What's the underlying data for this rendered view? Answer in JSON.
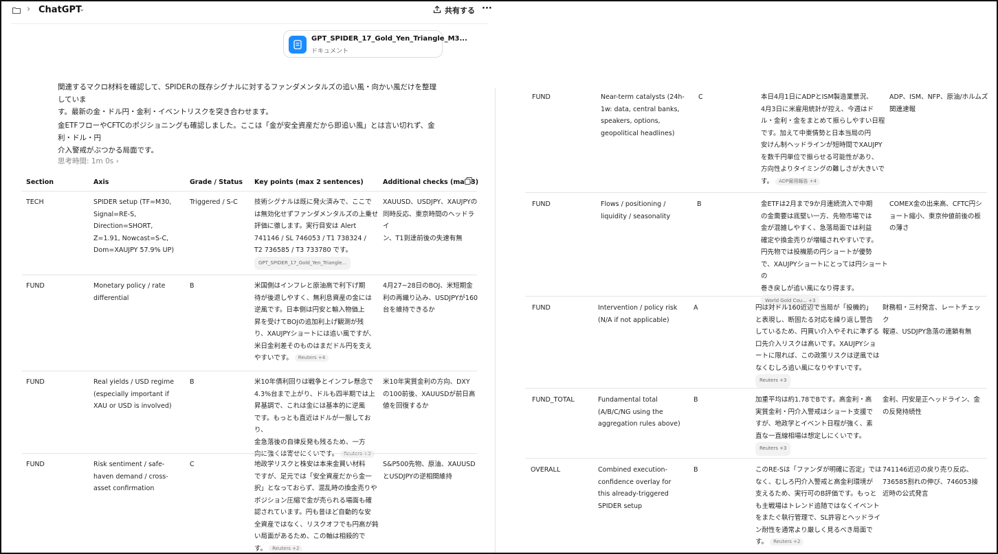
{
  "header": {
    "app_title": "ChatGPT",
    "share_label": "共有する",
    "more_label": "···"
  },
  "doc_card": {
    "name": "GPT_SPIDER_17_Gold_Yen_Triangle_M3...",
    "type": "ドキュメント"
  },
  "paragraphs": [
    "関連するマクロ材料を確認して、SPIDERの既存シグナルに対するファンダメンタルズの追い風・向かい風だけを整理していま",
    "す。最新の金・ドル円・金利・イベントリスクを突き合わせます。",
    "金ETFフローやCFTCのポジショニングも確認しました。ここは「金が安全資産だから即追い風」とは言い切れず、金利・ドル・円",
    "介入警戒がぶつかる局面です。"
  ],
  "thinking_label": "思考時間: 1m 0s ›",
  "table": {
    "headers": [
      "Section",
      "Axis",
      "Grade / Status",
      "Key points (max 2 sentences)",
      "Additional checks (max 3)"
    ],
    "rows_left": [
      {
        "section": "TECH",
        "axis": [
          "SPIDER setup (TF=M30,",
          "Signal=RE-S,",
          "Direction=SHORT,",
          "Z=1.91, Nowcast=S-C,",
          "Dom=XAUJPY 57.9% UP)"
        ],
        "grade": "Triggered / S-C",
        "key": [
          "技術シグナルは既に発火済みで、ここで",
          "は無効化せずファンダメンタルズの上乗せ",
          "評価に徹します。実行目安は Alert",
          "741146 / SL 746053 / T1 738324 /",
          "T2 736585 / T3 733780 です。"
        ],
        "source": "GPT_SPIDER_17_Gold_Yen_Triangle...",
        "checks": [
          "XAUUSD、USDJPY、XAUJPYの",
          "同時反応、東京時間のヘッドライ",
          "ン、T1到達前後の失速有無"
        ]
      },
      {
        "section": "FUND",
        "axis": [
          "Monetary policy / rate",
          "differential"
        ],
        "grade": "B",
        "key": [
          "米国側はインフレと原油高で利下げ期",
          "待が後退しやすく、無利息資産の金には",
          "逆風です。日本側は円安と輸入物価上",
          "昇を受けてBOJの追加利上げ観測が残",
          "り、XAUJPYショートには追い風ですが、",
          "米日金利差そのものはまだドル円を支え",
          "やすいです。"
        ],
        "source": "Reuters +4",
        "checks": [
          "4月27~28日のBOJ、米短期金",
          "利の再織り込み、USDJPYが160",
          "台を維持できるか"
        ]
      },
      {
        "section": "FUND",
        "axis": [
          "Real yields / USD regime",
          "(especially important if",
          "XAU or USD is involved)"
        ],
        "grade": "B",
        "key": [
          "米10年債利回りは戦争とインフレ懸念で",
          "4.3%台まで上がり、ドルも四半期では上",
          "昇基調で、これは金には基本的に逆風",
          "です。もっとも直近はドルが一服しており、",
          "金急落後の自律反発も残るため、一方",
          "向に強くは寄せにくいです。"
        ],
        "source": "Reuters +3",
        "checks": [
          "米10年実質金利の方向、DXY",
          "の100前後、XAUUSDが前日高",
          "値を回復するか"
        ]
      },
      {
        "section": "FUND",
        "axis": [
          "Risk sentiment / safe-",
          "haven demand / cross-",
          "asset confirmation"
        ],
        "grade": "C",
        "key": [
          "地政学リスクと株安は本来金買い材料",
          "ですが、足元では「安全資産だから金一",
          "択」となっておらず、混乱時の換金売りや",
          "ポジション圧縮で金が売られる場面も確",
          "認されています。円も昔ほど自動的な安",
          "全資産ではなく、リスクオフでも円高が鈍",
          "い局面があるため、この軸は相殺的で",
          "す。"
        ],
        "source": "Reuters +2",
        "checks": [
          "S&P500先物、原油、XAUUSD",
          "とUSDJPYの逆相関維持"
        ]
      }
    ],
    "rows_right": [
      {
        "section": "FUND",
        "axis": [
          "Near-term catalysts (24h-",
          "1w: data, central banks,",
          "speakers, options,",
          "geopolitical headlines)"
        ],
        "grade": "C",
        "key": [
          "本日4月1日にADPとISM製造業景況、",
          "4月3日に米雇用統計が控え、今週はド",
          "ル・金利・金をまとめて振らしやすい日程",
          "です。加えて中東情勢と日本当局の円",
          "安けん制ヘッドラインが短時間でXAUJPY",
          "を数千円単位で振らせる可能性があり、",
          "方向性よりタイミングの難しさが大きいで",
          "す。"
        ],
        "source": "ADP雇用報告 +4",
        "checks": [
          "ADP、ISM、NFP、原油/ホルムズ",
          "関連速報"
        ]
      },
      {
        "section": "FUND",
        "axis": [
          "Flows / positioning /",
          "liquidity / seasonality"
        ],
        "grade": "B",
        "key": [
          "金ETFは2月まで9か月連続流入で中期",
          "の金需要は底堅い一方、先物市場では",
          "金が混雑しやすく、急落局面では利益",
          "確定や換金売りが増幅されやすいです。",
          "円先物では投機筋の円ショートが優勢",
          "で、XAUJPYショートにとっては円ショートの",
          "巻き戻しが追い風になり得ます。"
        ],
        "source": "World Gold Cou... +3",
        "checks": [
          "COMEX金の出来高、CFTC円シ",
          "ョート縮小、東京仲値前後の板",
          "の薄さ"
        ]
      },
      {
        "section": "FUND",
        "axis": [
          "Intervention / policy risk",
          "(N/A if not applicable)"
        ],
        "grade": "A",
        "key": [
          "円は対ドル160近辺で当局が「投機的」",
          "と表現し、断固たる対応を繰り返し警告",
          "しているため、円買い介入やそれに準ずる",
          "口先介入リスクは高いです。XAUJPYショ",
          "ートに限れば、この政策リスクは逆風では",
          "なくむしろ追い風になりやすいです。"
        ],
        "source": "Reuters +3",
        "checks": [
          "財務相・三村発言、レートチェック",
          "報道、USDJPY急落の連鎖有無"
        ]
      },
      {
        "section": "FUND_TOTAL",
        "axis": [
          "Fundamental total",
          "(A/B/C/NG using the",
          "aggregation rules above)"
        ],
        "grade": "B",
        "key": [
          "加重平均は約1.78でBです。高金利・高",
          "実質金利・円介入警戒はショート支援で",
          "すが、地政学とイベント日程が強く、素",
          "直な一直線相場は想定しにくいです。"
        ],
        "source": "Reuters +3",
        "checks": [
          "金利、円安是正ヘッドライン、金",
          "の反発持続性"
        ]
      },
      {
        "section": "OVERALL",
        "axis": [
          "Combined execution-",
          "confidence overlay for",
          "this already-triggered",
          "SPIDER setup"
        ],
        "grade": "B",
        "key": [
          "このRE-Sは「ファンダが明確に否定」では",
          "なく、むしろ円介入警戒と高金利環境が",
          "支えるため、実行可のB評価です。もっと",
          "も主戦場はトレンド追随ではなくイベント",
          "をまたぐ執行管理で、SL許容とヘッドライ",
          "ン耐性を通常より厳しく見るべき局面で",
          "す。"
        ],
        "source": "Reuters +2",
        "checks": [
          "741146近辺の戻り売り反応、",
          "736585割れの伸び、746053接",
          "近時の公式発言"
        ]
      }
    ]
  }
}
